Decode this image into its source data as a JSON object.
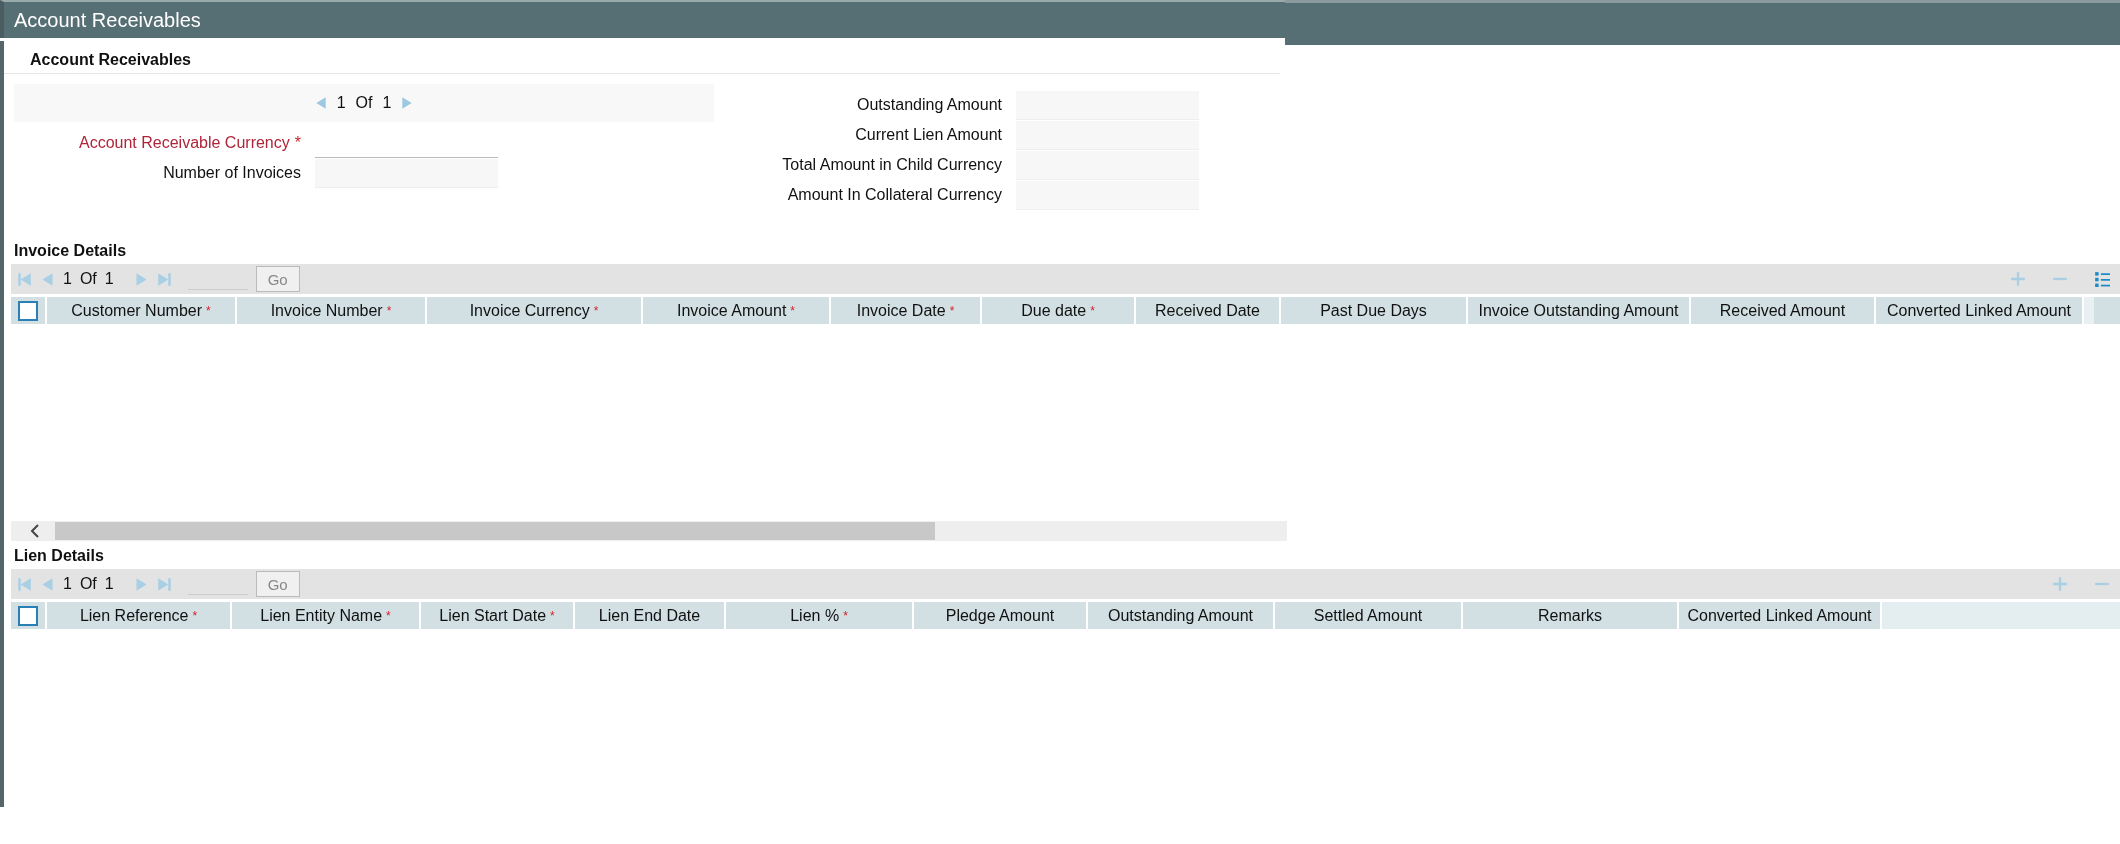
{
  "window": {
    "title": "Account Receivables"
  },
  "section": {
    "title": "Account Receivables",
    "pager": {
      "current": "1",
      "of": "Of",
      "total": "1"
    },
    "left_fields": [
      {
        "label": "Account Receivable Currency",
        "required_mark": "*",
        "kind": "underline"
      },
      {
        "label": "Number of Invoices",
        "kind": "box"
      }
    ],
    "right_fields": [
      {
        "label": "Outstanding Amount"
      },
      {
        "label": "Current Lien Amount"
      },
      {
        "label": "Total Amount in Child Currency"
      },
      {
        "label": "Amount In Collateral Currency"
      }
    ]
  },
  "grids": [
    {
      "title": "Invoice Details",
      "pager": {
        "current": "1",
        "of": "Of",
        "total": "1"
      },
      "go": "Go",
      "scrollbar": true,
      "select_all": {
        "checked": false
      },
      "tools": [
        {
          "kind": "add"
        },
        {
          "kind": "remove"
        },
        {
          "kind": "columns"
        }
      ],
      "columns": [
        {
          "label": "Customer Number",
          "required_mark": "*"
        },
        {
          "label": "Invoice Number",
          "required_mark": "*"
        },
        {
          "label": "Invoice Currency",
          "required_mark": "*"
        },
        {
          "label": "Invoice Amount",
          "required_mark": "*"
        },
        {
          "label": "Invoice Date",
          "required_mark": "*"
        },
        {
          "label": "Due date",
          "required_mark": "*"
        },
        {
          "label": "Received Date"
        },
        {
          "label": "Past Due Days"
        },
        {
          "label": "Invoice Outstanding Amount"
        },
        {
          "label": "Received Amount"
        },
        {
          "label": "Converted Linked Amount"
        }
      ]
    },
    {
      "title": "Lien Details",
      "pager": {
        "current": "1",
        "of": "Of",
        "total": "1"
      },
      "go": "Go",
      "scrollbar": false,
      "select_all": {
        "checked": false
      },
      "tools": [
        {
          "kind": "add"
        },
        {
          "kind": "remove"
        }
      ],
      "columns": [
        {
          "label": "Lien Reference",
          "required_mark": "*"
        },
        {
          "label": "Lien Entity Name",
          "required_mark": "*"
        },
        {
          "label": "Lien Start Date",
          "required_mark": "*"
        },
        {
          "label": "Lien End Date"
        },
        {
          "label": "Lien %",
          "required_mark": "*"
        },
        {
          "label": "Pledge Amount"
        },
        {
          "label": "Outstanding Amount"
        },
        {
          "label": "Settled Amount"
        },
        {
          "label": "Remarks"
        },
        {
          "label": "Converted Linked Amount"
        }
      ]
    }
  ]
}
